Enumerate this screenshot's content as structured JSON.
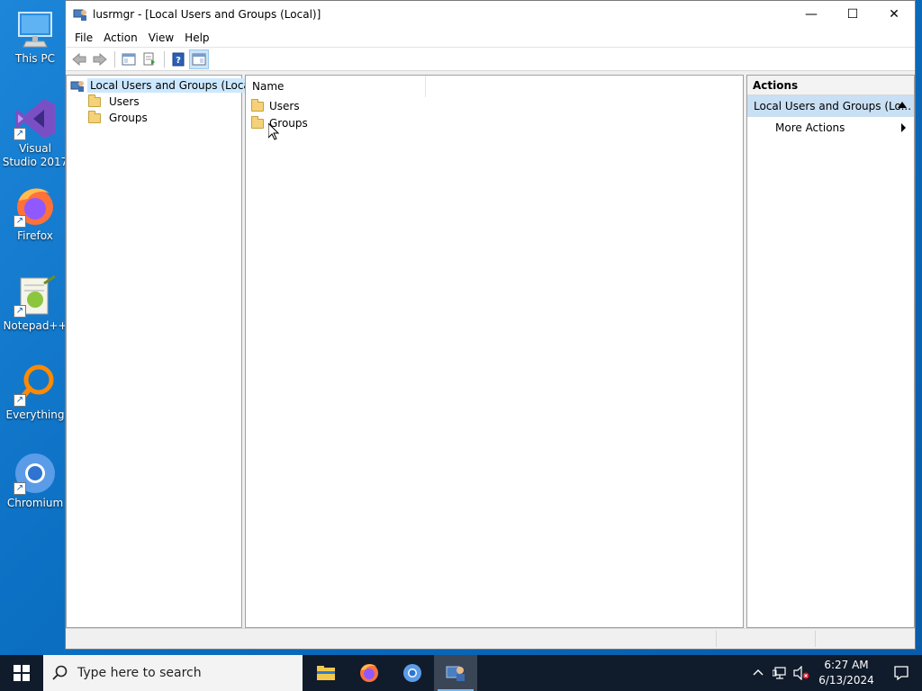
{
  "desktop": {
    "icons": [
      {
        "label": "This PC",
        "shortcut": false
      },
      {
        "label": "Visual Studio 2017",
        "shortcut": true
      },
      {
        "label": "Firefox",
        "shortcut": true
      },
      {
        "label": "Notepad++",
        "shortcut": true
      },
      {
        "label": "Everything",
        "shortcut": true
      },
      {
        "label": "Chromium",
        "shortcut": true
      }
    ]
  },
  "window": {
    "title": "lusrmgr - [Local Users and Groups (Local)]",
    "controls": {
      "minimize": "—",
      "maximize": "☐",
      "close": "✕"
    },
    "menu": [
      "File",
      "Action",
      "View",
      "Help"
    ],
    "toolbar": [
      {
        "icon": "back-arrow-icon",
        "enabled": false
      },
      {
        "icon": "forward-arrow-icon",
        "enabled": false
      },
      {
        "icon": "show-hide-console-tree-icon",
        "enabled": true
      },
      {
        "icon": "export-list-icon",
        "enabled": true
      },
      {
        "icon": "help-icon",
        "enabled": true
      },
      {
        "icon": "show-hide-action-pane-icon",
        "enabled": true,
        "active": true
      }
    ],
    "tree": {
      "root": "Local Users and Groups (Local)",
      "children": [
        "Users",
        "Groups"
      ]
    },
    "list": {
      "column": "Name",
      "rows": [
        "Users",
        "Groups"
      ]
    },
    "actions": {
      "header": "Actions",
      "group": "Local Users and Groups (Lo...",
      "items": [
        "More Actions"
      ]
    }
  },
  "taskbar": {
    "search_placeholder": "Type here to search",
    "apps": [
      "file-explorer-icon",
      "firefox-icon",
      "chromium-icon",
      "lusrmgr-icon"
    ],
    "time": "6:27 AM",
    "date": "6/13/2024"
  },
  "colors": {
    "desktop_bg": "#0b6fc2",
    "selection": "#cce8ff",
    "actions_group_bg": "#c9dff4",
    "taskbar_bg": "#101b2b"
  }
}
